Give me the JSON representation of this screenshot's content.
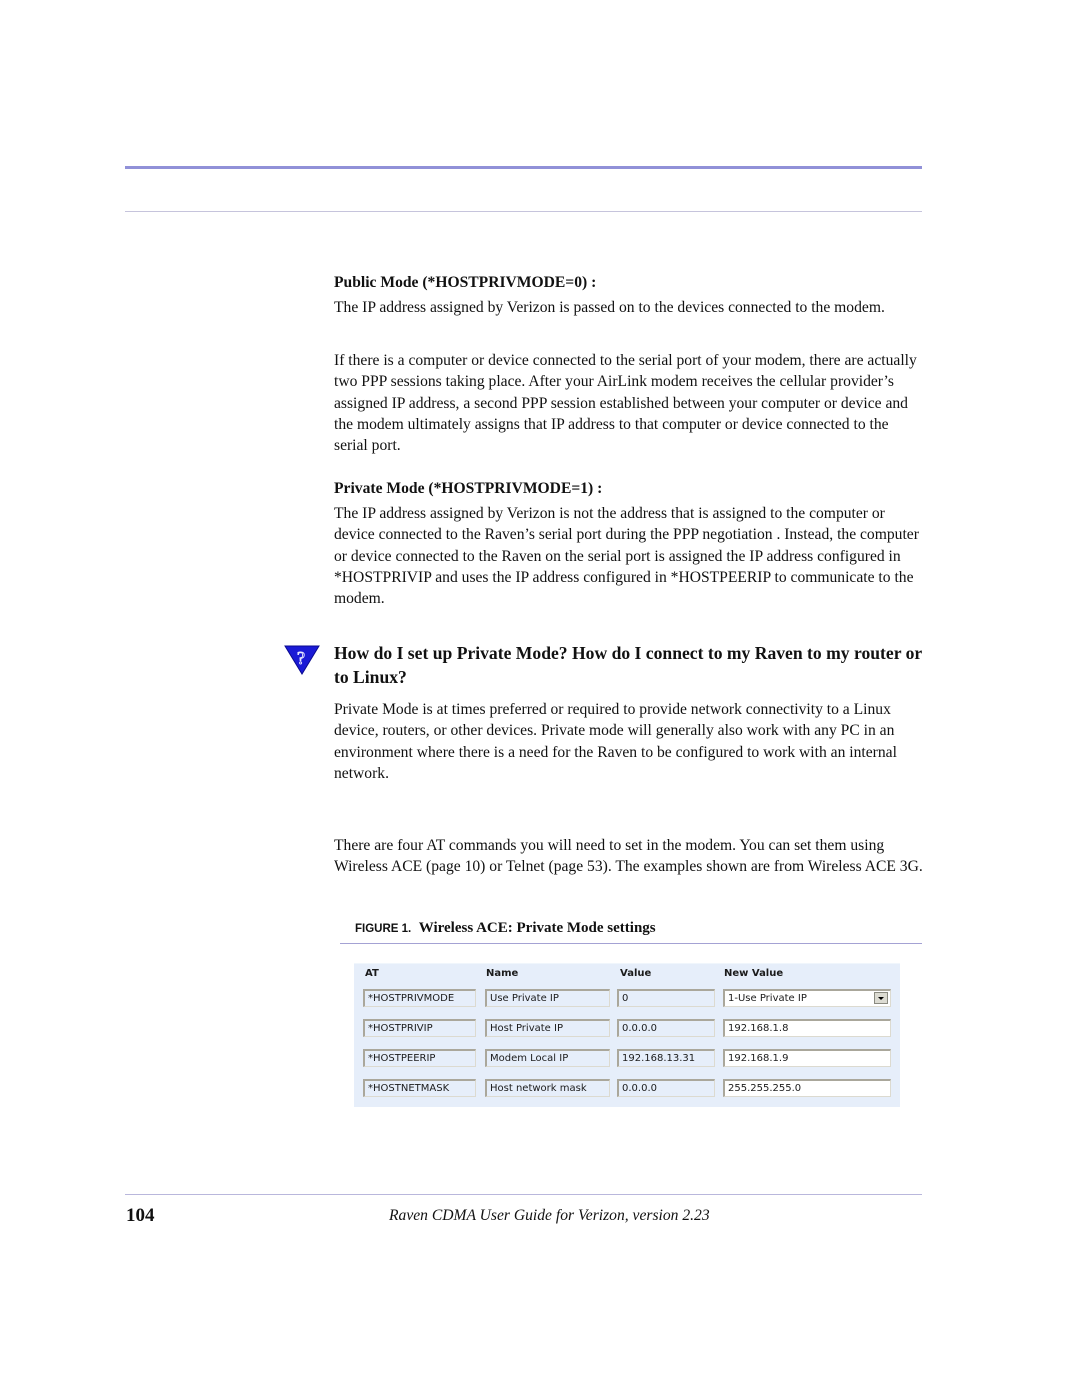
{
  "sections": {
    "public_mode": {
      "heading": "Public Mode (*HOSTPRIVMODE=0) :",
      "paragraphs": [
        "The IP address assigned by Verizon is passed on to the devices connected to the modem.",
        "If there is a computer or device connected to the serial port of your modem, there are actually two PPP sessions taking place.  After your AirLink modem receives the cellular provider’s assigned IP address, a second PPP session established between your computer or device and the modem ultimately assigns that IP address to that computer or device connected to the serial port."
      ]
    },
    "private_mode": {
      "heading": "Private Mode (*HOSTPRIVMODE=1) :",
      "paragraphs": [
        "The IP address assigned by Verizon is not the address that is assigned to the com­puter or device connected to the Raven’s serial port during the PPP negotiation . Instead, the computer or device connected to the Raven on the serial port is assigned the IP address configured in *HOSTPRIVIP and uses the IP address con­figured in *HOSTPEERIP to communicate to the modem."
      ]
    },
    "faq": {
      "icon": "question-icon",
      "question": "How do I set up Private Mode? How do I connect to my Raven to my router or to Linux?",
      "paragraphs": [
        "Private Mode is at times preferred or required to provide network connectivity to a Linux device, routers, or other devices.  Private mode will generally also work with any PC in an environment where there is a need for the Raven to be configured to work with an internal network.",
        "There are four AT commands you will need to set in the modem.  You can set them using Wireless ACE (page 10) or Telnet (page 53).  The examples shown are from Wireless ACE 3G."
      ]
    }
  },
  "figure": {
    "label": "FIGURE 1.",
    "caption": "Wireless ACE: Private Mode settings",
    "columns": [
      "AT",
      "Name",
      "Value",
      "New Value"
    ],
    "rows": [
      {
        "at": "*HOSTPRIVMODE",
        "name": "Use Private IP",
        "value": "0",
        "new_value": "1-Use Private IP"
      },
      {
        "at": "*HOSTPRIVIP",
        "name": "Host Private IP",
        "value": "0.0.0.0",
        "new_value": "192.168.1.8"
      },
      {
        "at": "*HOSTPEERIP",
        "name": "Modem Local IP",
        "value": "192.168.13.31",
        "new_value": "192.168.1.9"
      },
      {
        "at": "*HOSTNETMASK",
        "name": "Host network mask",
        "value": "0.0.0.0",
        "new_value": "255.255.255.0"
      }
    ]
  },
  "footer": {
    "page_number": "104",
    "title": "Raven CDMA User Guide for Verizon, version 2.23"
  },
  "colors": {
    "header_rule": "#9191d8",
    "icon_blue": "#1a1ad6"
  }
}
